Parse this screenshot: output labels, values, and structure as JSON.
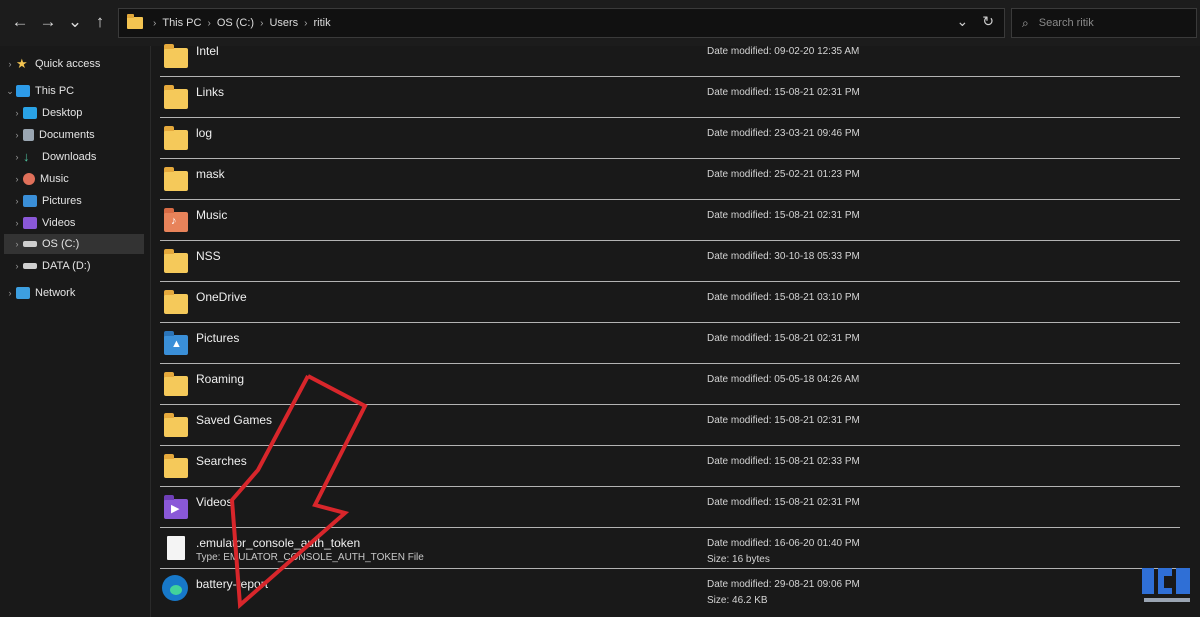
{
  "nav": {
    "back": "←",
    "forward": "→",
    "recent": "⌄",
    "up": "↑"
  },
  "address": {
    "crumbs": [
      "This PC",
      "OS (C:)",
      "Users",
      "ritik"
    ],
    "separator": "›",
    "dropdown": "⌄",
    "refresh": "↻"
  },
  "search": {
    "placeholder": "Search ritik",
    "icon": "⌕"
  },
  "sidebar": {
    "items": [
      {
        "label": "Quick access",
        "icon": "star-icon"
      },
      {
        "label": "This PC",
        "icon": "computer-icon"
      },
      {
        "label": "Desktop",
        "icon": "desktop-icon"
      },
      {
        "label": "Documents",
        "icon": "documents-icon"
      },
      {
        "label": "Downloads",
        "icon": "downloads-icon"
      },
      {
        "label": "Music",
        "icon": "music-icon"
      },
      {
        "label": "Pictures",
        "icon": "pictures-icon"
      },
      {
        "label": "Videos",
        "icon": "videos-icon"
      },
      {
        "label": "OS (C:)",
        "icon": "drive-icon"
      },
      {
        "label": "DATA (D:)",
        "icon": "drive-icon"
      },
      {
        "label": "Network",
        "icon": "network-icon"
      }
    ]
  },
  "files": [
    {
      "name": "Intel",
      "date": "Date modified: 09-02-20 12:35 AM"
    },
    {
      "name": "Links",
      "date": "Date modified: 15-08-21 02:31 PM"
    },
    {
      "name": "log",
      "date": "Date modified: 23-03-21 09:46 PM"
    },
    {
      "name": "mask",
      "date": "Date modified: 25-02-21 01:23 PM"
    },
    {
      "name": "Music",
      "date": "Date modified: 15-08-21 02:31 PM"
    },
    {
      "name": "NSS",
      "date": "Date modified: 30-10-18 05:33 PM"
    },
    {
      "name": "OneDrive",
      "date": "Date modified: 15-08-21 03:10 PM"
    },
    {
      "name": "Pictures",
      "date": "Date modified: 15-08-21 02:31 PM"
    },
    {
      "name": "Roaming",
      "date": "Date modified: 05-05-18 04:26 AM"
    },
    {
      "name": "Saved Games",
      "date": "Date modified: 15-08-21 02:31 PM"
    },
    {
      "name": "Searches",
      "date": "Date modified: 15-08-21 02:33 PM"
    },
    {
      "name": "Videos",
      "date": "Date modified: 15-08-21 02:31 PM"
    },
    {
      "name": ".emulator_console_auth_token",
      "type": "Type: EMULATOR_CONSOLE_AUTH_TOKEN File",
      "date": "Date modified: 16-06-20 01:40 PM",
      "size": "Size: 16 bytes"
    },
    {
      "name": "battery-report",
      "date": "Date modified: 29-08-21 09:06 PM",
      "size": "Size: 46.2 KB"
    }
  ],
  "colors": {
    "annotation_arrow": "#d8262b",
    "folder": "#f5c95a",
    "background": "#191919"
  }
}
